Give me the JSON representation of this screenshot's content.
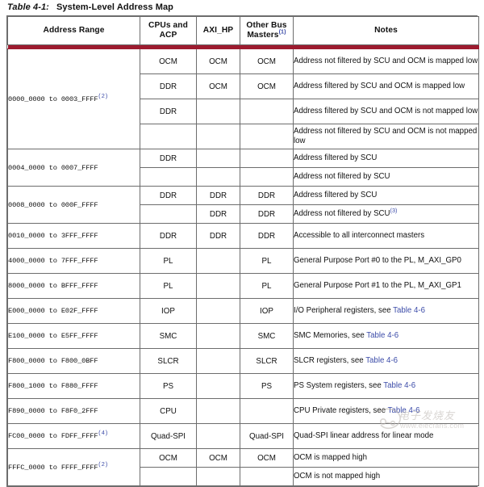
{
  "caption": {
    "label": "Table 4-1:",
    "title": "System-Level Address Map"
  },
  "colors": {
    "accent_red": "#9d1b2f",
    "link_blue": "#3b4ba8",
    "shade_gray": "#e2e2e2",
    "border_gray": "#6d6d6d"
  },
  "table": {
    "columns": [
      {
        "key": "range",
        "label": "Address Range"
      },
      {
        "key": "cpu_acp",
        "label": "CPUs and ACP"
      },
      {
        "key": "axi_hp",
        "label": "AXI_HP"
      },
      {
        "key": "other_bus",
        "label": "Other Bus Masters",
        "footnote": "(1)"
      },
      {
        "key": "notes",
        "label": "Notes"
      }
    ],
    "groups": [
      {
        "range": "0000_0000 to 0003_FFFF",
        "range_footnote": "(2)",
        "rows": [
          {
            "cpu_acp": "OCM",
            "axi_hp": "OCM",
            "other_bus": "OCM",
            "notes": "Address not filtered by SCU and OCM is mapped low",
            "shaded": []
          },
          {
            "cpu_acp": "DDR",
            "axi_hp": "OCM",
            "other_bus": "OCM",
            "notes": "Address filtered by SCU and OCM is mapped low",
            "shaded": []
          },
          {
            "cpu_acp": "DDR",
            "axi_hp": "",
            "other_bus": "",
            "notes": "Address filtered by SCU and OCM is not mapped low",
            "shaded": [
              "axi_hp",
              "other_bus"
            ]
          },
          {
            "cpu_acp": "",
            "axi_hp": "",
            "other_bus": "",
            "notes": "Address not filtered by SCU and OCM is not mapped low",
            "shaded": [
              "cpu_acp",
              "axi_hp",
              "other_bus"
            ]
          }
        ]
      },
      {
        "range": "0004_0000 to 0007_FFFF",
        "range_footnote": "",
        "rows": [
          {
            "cpu_acp": "DDR",
            "axi_hp": "",
            "other_bus": "",
            "notes": "Address filtered by SCU",
            "shaded": [
              "axi_hp",
              "other_bus"
            ]
          },
          {
            "cpu_acp": "",
            "axi_hp": "",
            "other_bus": "",
            "notes": "Address not filtered by SCU",
            "shaded": [
              "cpu_acp",
              "axi_hp",
              "other_bus"
            ]
          }
        ]
      },
      {
        "range": "0008_0000 to 000F_FFFF",
        "range_footnote": "",
        "rows": [
          {
            "cpu_acp": "DDR",
            "axi_hp": "DDR",
            "other_bus": "DDR",
            "notes": "Address filtered by SCU",
            "shaded": []
          },
          {
            "cpu_acp": "",
            "axi_hp": "DDR",
            "other_bus": "DDR",
            "notes": "Address not filtered by SCU",
            "notes_footnote": "(3)",
            "shaded": [
              "cpu_acp"
            ]
          }
        ]
      },
      {
        "range": "0010_0000 to 3FFF_FFFF",
        "range_footnote": "",
        "rows": [
          {
            "cpu_acp": "DDR",
            "axi_hp": "DDR",
            "other_bus": "DDR",
            "notes": "Accessible to all interconnect masters",
            "shaded": []
          }
        ]
      },
      {
        "range": "4000_0000 to 7FFF_FFFF",
        "range_footnote": "",
        "rows": [
          {
            "cpu_acp": "PL",
            "axi_hp": "",
            "other_bus": "PL",
            "notes": "General Purpose Port #0 to the PL, M_AXI_GP0",
            "shaded": [
              "axi_hp"
            ]
          }
        ]
      },
      {
        "range": "8000_0000 to BFFF_FFFF",
        "range_footnote": "",
        "rows": [
          {
            "cpu_acp": "PL",
            "axi_hp": "",
            "other_bus": "PL",
            "notes": "General Purpose Port #1 to the PL, M_AXI_GP1",
            "shaded": [
              "axi_hp"
            ]
          }
        ]
      },
      {
        "range": "E000_0000 to E02F_FFFF",
        "range_footnote": "",
        "rows": [
          {
            "cpu_acp": "IOP",
            "axi_hp": "",
            "other_bus": "IOP",
            "notes": "I/O Peripheral registers, see ",
            "notes_link": "Table 4-6",
            "shaded": [
              "axi_hp"
            ]
          }
        ]
      },
      {
        "range": "E100_0000 to E5FF_FFFF",
        "range_footnote": "",
        "rows": [
          {
            "cpu_acp": "SMC",
            "axi_hp": "",
            "other_bus": "SMC",
            "notes": "SMC Memories, see ",
            "notes_link": "Table 4-6",
            "shaded": [
              "axi_hp"
            ]
          }
        ]
      },
      {
        "range": "F800_0000 to F800_0BFF",
        "range_footnote": "",
        "rows": [
          {
            "cpu_acp": "SLCR",
            "axi_hp": "",
            "other_bus": "SLCR",
            "notes": "SLCR registers, see ",
            "notes_link": "Table 4-6",
            "shaded": [
              "axi_hp"
            ]
          }
        ]
      },
      {
        "range": "F800_1000 to F880_FFFF",
        "range_footnote": "",
        "rows": [
          {
            "cpu_acp": "PS",
            "axi_hp": "",
            "other_bus": "PS",
            "notes": "PS System registers, see ",
            "notes_link": "Table 4-6",
            "shaded": [
              "axi_hp"
            ]
          }
        ]
      },
      {
        "range": "F890_0000 to F8F0_2FFF",
        "range_footnote": "",
        "rows": [
          {
            "cpu_acp": "CPU",
            "axi_hp": "",
            "other_bus": "",
            "notes": "CPU Private registers, see ",
            "notes_link": "Table 4-6",
            "shaded": [
              "axi_hp",
              "other_bus"
            ]
          }
        ]
      },
      {
        "range": "FC00_0000 to FDFF_FFFF",
        "range_footnote": "(4)",
        "rows": [
          {
            "cpu_acp": "Quad-SPI",
            "axi_hp": "",
            "other_bus": "Quad-SPI",
            "notes": "Quad-SPI linear address for linear mode",
            "shaded": [
              "axi_hp"
            ]
          }
        ]
      },
      {
        "range": "FFFC_0000 to FFFF_FFFF",
        "range_footnote": "(2)",
        "rows": [
          {
            "cpu_acp": "OCM",
            "axi_hp": "OCM",
            "other_bus": "OCM",
            "notes": "OCM is mapped high",
            "shaded": []
          },
          {
            "cpu_acp": "",
            "axi_hp": "",
            "other_bus": "",
            "notes": "OCM is not mapped high",
            "shaded": [
              "cpu_acp",
              "axi_hp",
              "other_bus"
            ]
          }
        ]
      }
    ]
  },
  "watermark": {
    "chinese": "电子发烧友",
    "url": "www.elecfans.com"
  }
}
